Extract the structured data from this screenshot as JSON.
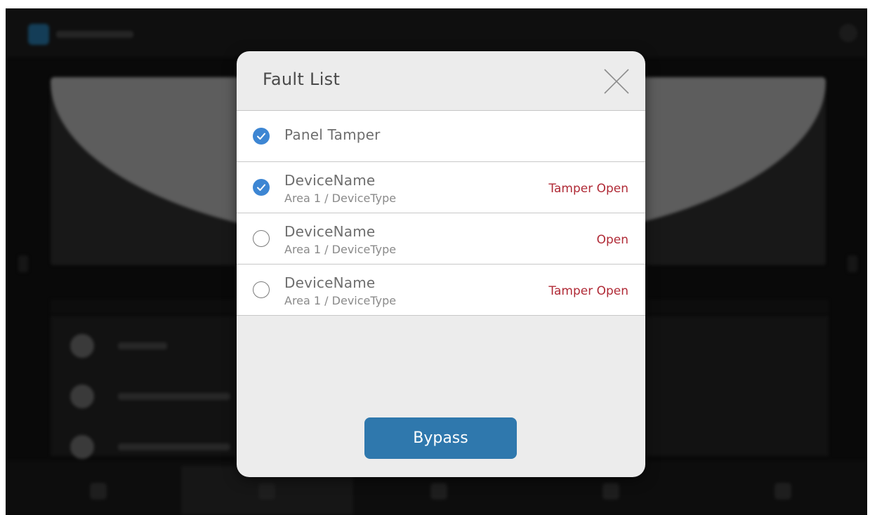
{
  "modal": {
    "title": "Fault List",
    "bypass_label": "Bypass"
  },
  "faults": [
    {
      "name": "Panel Tamper",
      "sub": "",
      "status": "",
      "checked": true
    },
    {
      "name": "DeviceName",
      "sub": "Area 1 / DeviceType",
      "status": "Tamper Open",
      "checked": true
    },
    {
      "name": "DeviceName",
      "sub": "Area 1 / DeviceType",
      "status": "Open",
      "checked": false
    },
    {
      "name": "DeviceName",
      "sub": "Area 1 / DeviceType",
      "status": "Tamper Open",
      "checked": false
    }
  ],
  "colors": {
    "accent": "#3d86d3",
    "button": "#2f78ad",
    "fault_status": "#b02a36"
  },
  "icons": {
    "close": "close-icon",
    "checked": "checkmark-circle-icon",
    "unchecked": "empty-circle-icon"
  }
}
